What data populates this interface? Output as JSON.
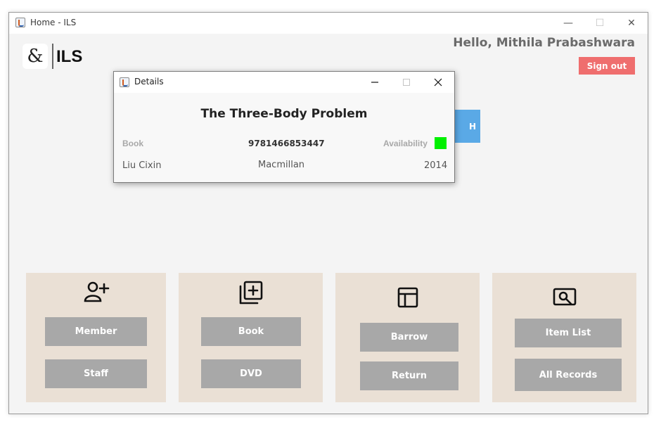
{
  "window": {
    "title": "Home - ILS",
    "controls": {
      "minimize": "—",
      "maximize": "☐",
      "close": "✕"
    }
  },
  "header": {
    "logo_glyph": "&",
    "brand": "ILS",
    "greeting": "Hello, Mithila Prabashwara",
    "signout_label": "Sign out",
    "signout_color": "#ef6e6e"
  },
  "partially_hidden_button": {
    "label": "H",
    "color": "#5aa9e6"
  },
  "panels": [
    {
      "icon": "add-person-icon",
      "buttons": [
        "Member",
        "Staff"
      ]
    },
    {
      "icon": "add-library-icon",
      "buttons": [
        "Book",
        "DVD"
      ]
    },
    {
      "icon": "layout-icon",
      "buttons": [
        "Barrow",
        "Return"
      ]
    },
    {
      "icon": "search-screen-icon",
      "buttons": [
        "Item List",
        "All Records"
      ]
    }
  ],
  "dialog": {
    "title": "Details",
    "heading": "The Three-Body Problem",
    "type_label": "Book",
    "isbn": "9781466853447",
    "availability_label": "Availability",
    "availability_color": "#00f000",
    "author": "Liu Cixin",
    "publisher": "Macmillan",
    "year": "2014"
  },
  "colors": {
    "panel_bg": "#eae0d5",
    "button_bg": "#a8a8a8"
  }
}
